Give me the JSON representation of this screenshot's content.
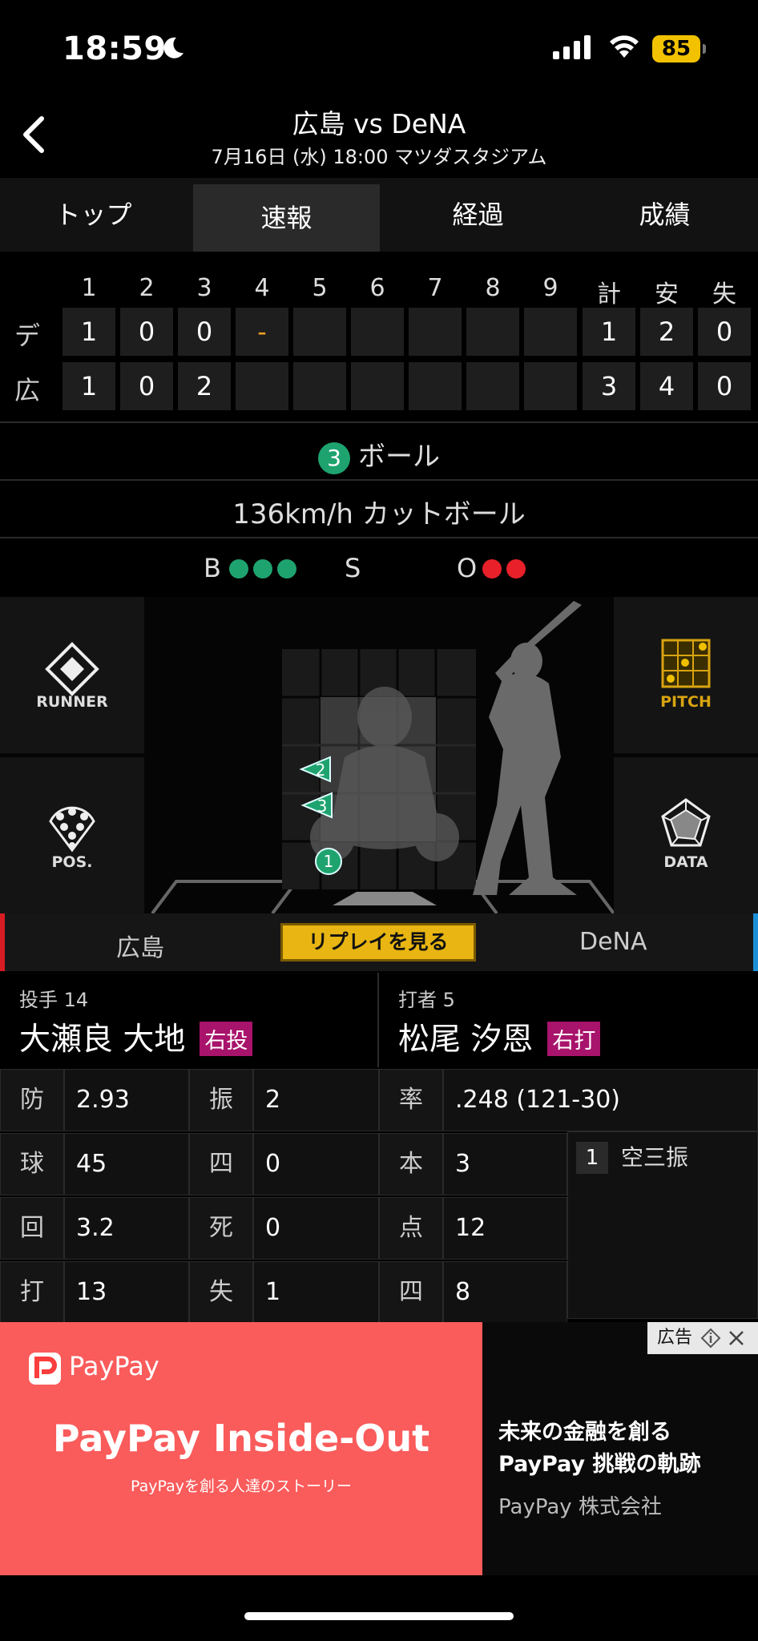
{
  "status": {
    "time": "18:59",
    "battery": "85"
  },
  "header": {
    "title": "広島 vs DeNA",
    "subtitle": "7月16日 (水) 18:00 マツダスタジアム"
  },
  "tabs": [
    {
      "label": "トップ",
      "active": false
    },
    {
      "label": "速報",
      "active": true
    },
    {
      "label": "経過",
      "active": false
    },
    {
      "label": "成績",
      "active": false
    }
  ],
  "scoreboard": {
    "columns": [
      "1",
      "2",
      "3",
      "4",
      "5",
      "6",
      "7",
      "8",
      "9",
      "計",
      "安",
      "失"
    ],
    "rows": [
      {
        "team": "デ",
        "cells": [
          "1",
          "0",
          "0",
          "-",
          "",
          "",
          "",
          "",
          "",
          "1",
          "2",
          "0"
        ]
      },
      {
        "team": "広",
        "cells": [
          "1",
          "0",
          "2",
          "",
          "",
          "",
          "",
          "",
          "",
          "3",
          "4",
          "0"
        ]
      }
    ]
  },
  "pitch": {
    "number": "3",
    "result": "ボール",
    "speed_type": "136km/h カットボール"
  },
  "count": {
    "b_label": "B",
    "s_label": "S",
    "o_label": "O",
    "balls": 3,
    "strikes": 0,
    "outs": 2
  },
  "field": {
    "runner_label": "RUNNER",
    "pos_label": "POS.",
    "pitch_label": "PITCH",
    "data_label": "DATA",
    "pitch_markers": [
      "1",
      "2",
      "3"
    ]
  },
  "teambar": {
    "home": "広島",
    "replay": "リプレイを見る",
    "away": "DeNA"
  },
  "pitcher": {
    "role": "投手 14",
    "name": "大瀬良 大地",
    "badge": "右投"
  },
  "batter": {
    "role": "打者 5",
    "name": "松尾 汐恩",
    "badge": "右打"
  },
  "pitcher_stats": [
    {
      "k1": "防",
      "v1": "2.93",
      "k2": "振",
      "v2": "2"
    },
    {
      "k1": "球",
      "v1": "45",
      "k2": "四",
      "v2": "0"
    },
    {
      "k1": "回",
      "v1": "3.2",
      "k2": "死",
      "v2": "0"
    },
    {
      "k1": "打",
      "v1": "13",
      "k2": "失",
      "v2": "1"
    }
  ],
  "batter_stats": [
    {
      "k": "率",
      "v": ".248 (121-30)"
    },
    {
      "k": "本",
      "v": "3"
    },
    {
      "k": "点",
      "v": "12"
    },
    {
      "k": "四",
      "v": "8"
    }
  ],
  "at_bat_results": [
    {
      "n": "1",
      "text": "空三振"
    }
  ],
  "ad": {
    "brand": "PayPay",
    "headline": "PayPay Inside-Out",
    "tagline": "PayPayを創る人達のストーリー",
    "right_line1": "未来の金融を創る",
    "right_line2": "PayPay 挑戦の軌跡",
    "company": "PayPay 株式会社",
    "ad_label": "広告"
  },
  "colors": {
    "green": "#1ea36f",
    "red": "#e8202a",
    "gold": "#d9a410",
    "badge": "#a8136b",
    "ad_bg": "#fa5b5b"
  }
}
